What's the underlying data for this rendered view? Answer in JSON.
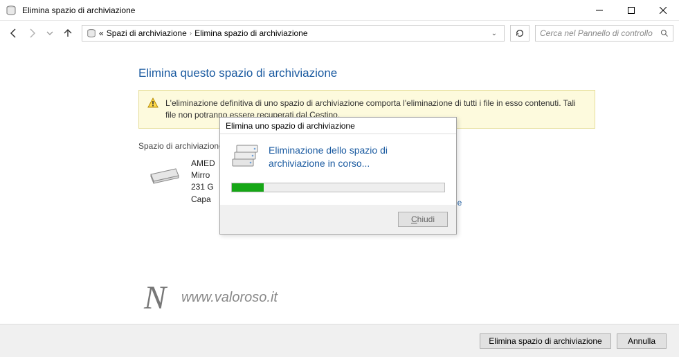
{
  "titlebar": {
    "title": "Elimina spazio di archiviazione"
  },
  "breadcrumb": {
    "prefix": "«",
    "item1": "Spazi di archiviazione",
    "item2": "Elimina spazio di archiviazione"
  },
  "search": {
    "placeholder": "Cerca nel Pannello di controllo"
  },
  "page": {
    "heading": "Elimina questo spazio di archiviazione",
    "warning": "L'eliminazione definitiva di uno spazio di archiviazione comporta l'eliminazione di tutti i file in esso contenuti. Tali file non potranno essere recuperati dal Cestino.",
    "section_label": "Spazio di archiviazione",
    "storage": {
      "name": "AMED",
      "type": "Mirro",
      "size": "231 G",
      "capacity_label": "Capa"
    },
    "file_link": "zza file",
    "watermark": "www.valoroso.it"
  },
  "dialog": {
    "title": "Elimina uno spazio di archiviazione",
    "message": "Eliminazione dello spazio di archiviazione in corso...",
    "progress_percent": 15,
    "close_label": "Chiudi",
    "close_underline": "C"
  },
  "bottom": {
    "confirm": "Elimina spazio di archiviazione",
    "cancel": "Annulla"
  }
}
